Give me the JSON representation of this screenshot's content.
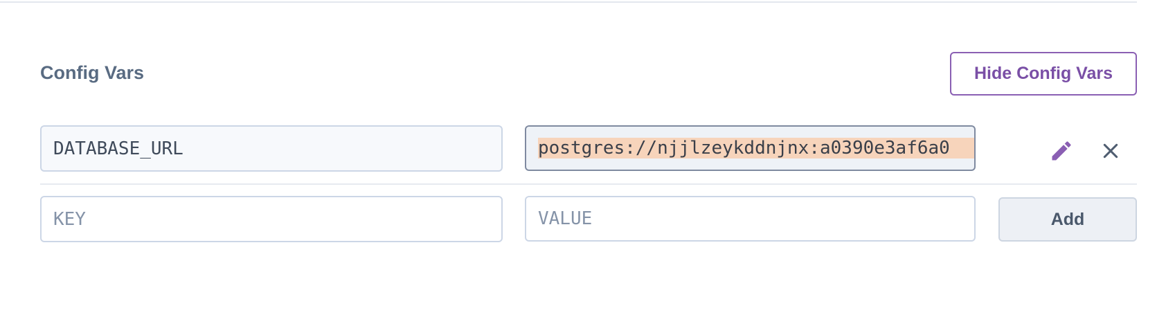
{
  "section": {
    "title": "Config Vars",
    "hide_button_label": "Hide Config Vars"
  },
  "config_vars": [
    {
      "key": "DATABASE_URL",
      "value": "postgres://njjlzeykddnjnx:a0390e3af6a0"
    }
  ],
  "new_var": {
    "key_placeholder": "KEY",
    "value_placeholder": "VALUE",
    "key_value": "",
    "value_value": "",
    "add_label": "Add"
  },
  "icons": {
    "edit": "pencil-icon",
    "delete": "close-icon"
  },
  "colors": {
    "accent": "#7a4fa6",
    "title": "#596b82",
    "selection_highlight": "#f7d4bb"
  }
}
